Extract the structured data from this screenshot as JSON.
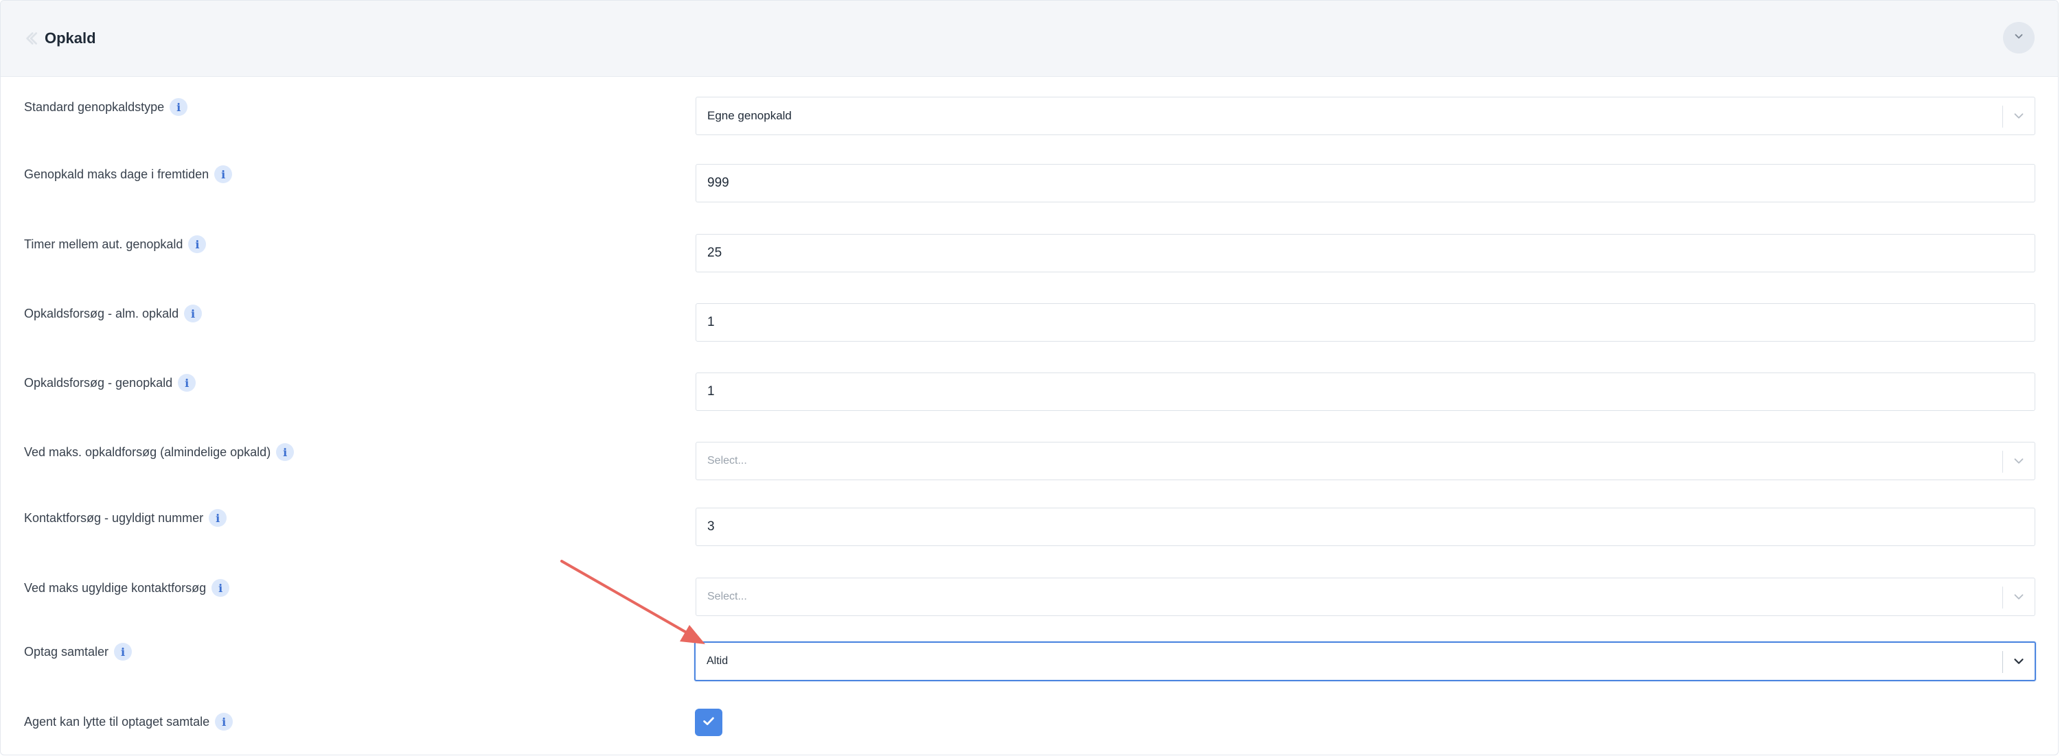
{
  "panel": {
    "title": "Opkald",
    "colors": {
      "header_bg": "#f4f6f9",
      "info_icon_bg": "#dce8fb",
      "info_icon_fg": "#3b6fd1",
      "focus_border": "#4d86e0",
      "checkbox_bg": "#4a88e6",
      "annotation_arrow": "#e8675f"
    },
    "icons": {
      "back": "chevron-left-icon",
      "collapse": "chevron-down-icon",
      "info": "info-icon",
      "select": "chevron-down-icon",
      "check": "checkmark-icon"
    }
  },
  "settings": [
    {
      "label": "Standard genopkaldstype",
      "type": "select",
      "value": "Egne genopkald"
    },
    {
      "label": "Genopkald maks dage i fremtiden",
      "type": "text",
      "value": "999"
    },
    {
      "label": "Timer mellem aut. genopkald",
      "type": "text",
      "value": "25"
    },
    {
      "label": "Opkaldsforsøg - alm. opkald",
      "type": "text",
      "value": "1"
    },
    {
      "label": "Opkaldsforsøg - genopkald",
      "type": "text",
      "value": "1"
    },
    {
      "label": "Ved maks. opkaldforsøg (almindelige opkald)",
      "type": "select",
      "placeholder": "Select..."
    },
    {
      "label": "Kontaktforsøg - ugyldigt nummer",
      "type": "text",
      "value": "3"
    },
    {
      "label": "Ved maks ugyldige kontaktforsøg",
      "type": "select",
      "placeholder": "Select..."
    },
    {
      "label": "Optag samtaler",
      "type": "select",
      "value": "Altid",
      "focused": true
    },
    {
      "label": "Agent kan lytte til optaget samtale",
      "type": "checkbox",
      "checked": true
    }
  ],
  "info_glyph": "i"
}
